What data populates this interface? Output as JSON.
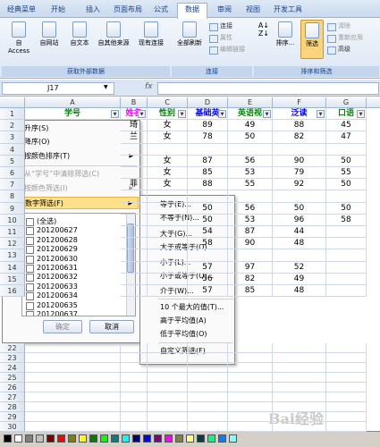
{
  "tabs": [
    "经典菜单",
    "开始",
    "插入",
    "页面布局",
    "公式",
    "数据",
    "审阅",
    "视图",
    "开发工具"
  ],
  "ribbon": {
    "group1": {
      "label": "获取外部数据",
      "buttons": [
        "自 Access",
        "自网站",
        "自文本",
        "自其他来源",
        "现有连接"
      ]
    },
    "group2": {
      "label": "连接",
      "big": "全部刷新",
      "small": [
        "连接",
        "属性",
        "编辑链接"
      ]
    },
    "group3": {
      "label": "排序和筛选",
      "sort": "排序...",
      "filter": "筛选",
      "small": [
        "清除",
        "重新应用",
        "高级"
      ]
    }
  },
  "formula_bar": {
    "name_box": "J17",
    "fx": "fx",
    "formula": ""
  },
  "columns": [
    "A",
    "B",
    "C",
    "D",
    "E",
    "F",
    "G"
  ],
  "headers": [
    "学号",
    "姓名",
    "性别",
    "基础英",
    "英语视",
    "泛读",
    "口语"
  ],
  "header_colors": [
    "#008000",
    "#ff00ff",
    "#008000",
    "#0000ff",
    "#008000",
    "#0000ff",
    "#008000"
  ],
  "rows": [
    {
      "num": "2",
      "b": "琦",
      "c": "女",
      "d": "89",
      "e": "49",
      "f": "88",
      "g": "45"
    },
    {
      "num": "3",
      "b": "兰",
      "c": "女",
      "d": "78",
      "e": "50",
      "f": "82",
      "g": "47"
    },
    {
      "num": "4",
      "b": "",
      "c": "",
      "d": "",
      "e": "",
      "f": "",
      "g": ""
    },
    {
      "num": "5",
      "b": "",
      "c": "女",
      "d": "87",
      "e": "56",
      "f": "90",
      "g": "50"
    },
    {
      "num": "6",
      "b": "",
      "c": "女",
      "d": "85",
      "e": "53",
      "f": "79",
      "g": "55"
    },
    {
      "num": "7",
      "b": "菲",
      "c": "女",
      "d": "88",
      "e": "55",
      "f": "92",
      "g": "50"
    },
    {
      "num": "8",
      "b": "",
      "c": "",
      "d": "",
      "e": "",
      "f": "",
      "g": ""
    },
    {
      "num": "9",
      "b": "",
      "c": "",
      "d": "50",
      "e": "56",
      "f": "50",
      "g": "50"
    },
    {
      "num": "10",
      "b": "",
      "c": "",
      "d": "50",
      "e": "53",
      "f": "96",
      "g": "58"
    },
    {
      "num": "11",
      "b": "",
      "c": "",
      "d": "54",
      "e": "87",
      "f": "44",
      "g": ""
    },
    {
      "num": "12",
      "b": "",
      "c": "",
      "d": "58",
      "e": "90",
      "f": "48",
      "g": ""
    },
    {
      "num": "13",
      "b": "",
      "c": "",
      "d": "",
      "e": "",
      "f": "",
      "g": ""
    },
    {
      "num": "14",
      "b": "",
      "c": "",
      "d": "57",
      "e": "97",
      "f": "52",
      "g": ""
    },
    {
      "num": "15",
      "b": "",
      "c": "",
      "d": "56",
      "e": "82",
      "f": "49",
      "g": ""
    },
    {
      "num": "16",
      "b": "",
      "c": "",
      "d": "57",
      "e": "85",
      "f": "48",
      "g": ""
    }
  ],
  "lower_rows": [
    "22",
    "23",
    "24",
    "25",
    "26",
    "27",
    "28",
    "29",
    "30"
  ],
  "filter_panel": {
    "sort_asc": "升序(S)",
    "sort_desc": "降序(O)",
    "sort_color": "按颜色排序(T)",
    "clear": "从“学号”中清除筛选(C)",
    "filter_color": "按颜色筛选(I)",
    "number_filter": "数字筛选(F)",
    "list": [
      "(全选)",
      "201200627",
      "201200628",
      "201200629",
      "201200630",
      "201200631",
      "201200632",
      "201200633",
      "201200634",
      "201200635",
      "201200637"
    ],
    "ok": "确定",
    "cancel": "取消"
  },
  "submenu": [
    "等于(E)...",
    "不等于(N)...",
    "大于(G)...",
    "大于或等于(O)...",
    "小于(L)...",
    "小于或等于(Q)...",
    "介于(W)...",
    "10 个最大的值(T)...",
    "高于平均值(A)",
    "低于平均值(O)",
    "自定义筛选(F)..."
  ],
  "palette": [
    "#000000",
    "#ffffff",
    "#808080",
    "#c0c0c0",
    "#800000",
    "#ff0000",
    "#808000",
    "#ffff00",
    "#008000",
    "#00ff00",
    "#008080",
    "#00ffff",
    "#000080",
    "#0000ff",
    "#800080",
    "#ff00ff",
    "#808040",
    "#ffff80",
    "#004040",
    "#00ff80",
    "#0080ff",
    "#80ffff"
  ],
  "watermark": "Bai经验"
}
